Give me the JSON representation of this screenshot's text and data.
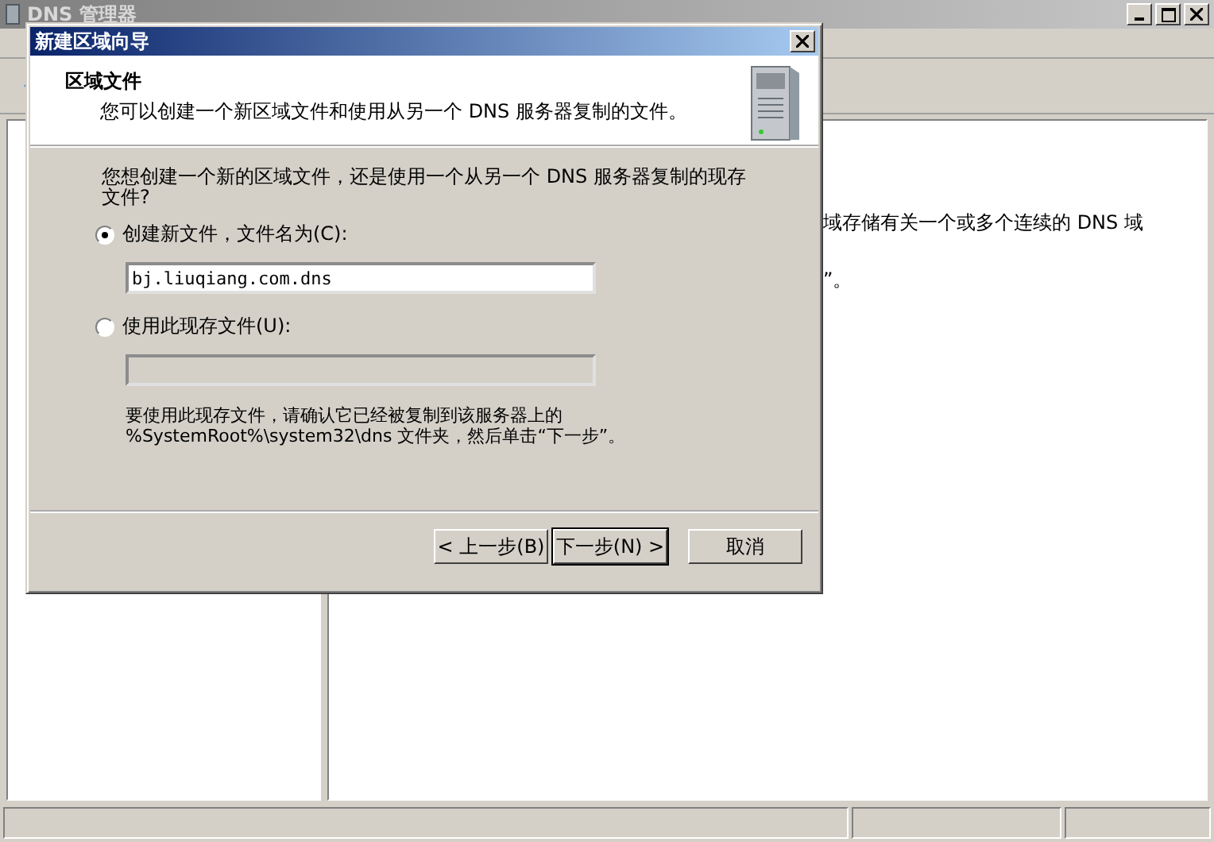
{
  "window": {
    "title": "DNS 管理器",
    "right_pane_lines": [
      "域存储有关一个或多个连续的 DNS 域",
      "”。"
    ]
  },
  "dialog": {
    "title": "新建区域向导",
    "heading": "区域文件",
    "subtitle": "您可以创建一个新区域文件和使用从另一个 DNS 服务器复制的文件。",
    "question_lines": [
      "您想创建一个新的区域文件，还是使用一个从另一个 DNS 服务器复制的现存",
      "文件?"
    ],
    "options": [
      {
        "label": "创建新文件，文件名为(C):",
        "selected": true,
        "field": {
          "value": "bj.liuqiang.com.dns",
          "disabled": false
        }
      },
      {
        "label": "使用此现存文件(U):",
        "selected": false,
        "field": {
          "disabled": true
        }
      }
    ],
    "note_lines": [
      "要使用此现存文件，请确认它已经被复制到该服务器上的",
      "%SystemRoot%\\system32\\dns 文件夹，然后单击“下一步”。"
    ],
    "buttons": [
      {
        "label": "< 上一步(B)",
        "default": false
      },
      {
        "label": "下一步(N) >",
        "default": true
      },
      {
        "label": "取消",
        "default": false
      }
    ]
  }
}
